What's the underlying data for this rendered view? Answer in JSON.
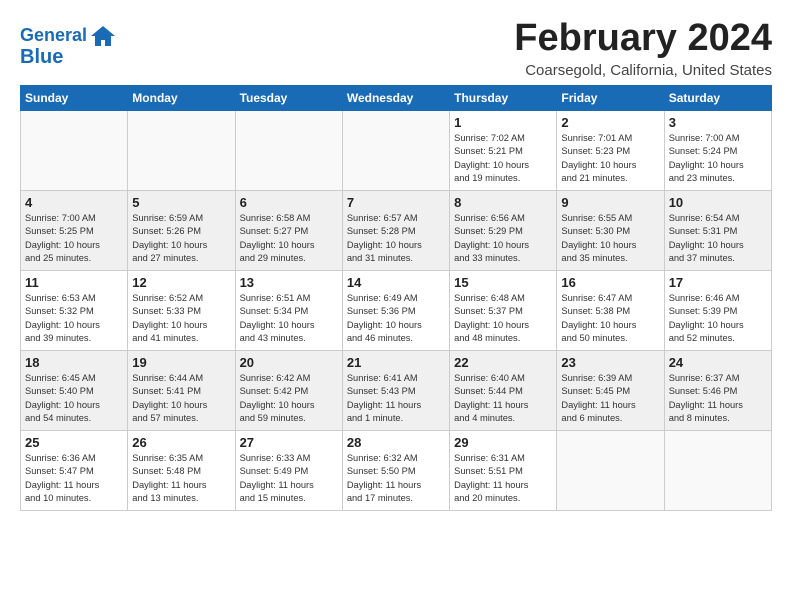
{
  "header": {
    "logo_line1": "General",
    "logo_line2": "Blue",
    "month_title": "February 2024",
    "location": "Coarsegold, California, United States"
  },
  "days_of_week": [
    "Sunday",
    "Monday",
    "Tuesday",
    "Wednesday",
    "Thursday",
    "Friday",
    "Saturday"
  ],
  "weeks": [
    {
      "alt": false,
      "days": [
        {
          "num": "",
          "info": ""
        },
        {
          "num": "",
          "info": ""
        },
        {
          "num": "",
          "info": ""
        },
        {
          "num": "",
          "info": ""
        },
        {
          "num": "1",
          "info": "Sunrise: 7:02 AM\nSunset: 5:21 PM\nDaylight: 10 hours\nand 19 minutes."
        },
        {
          "num": "2",
          "info": "Sunrise: 7:01 AM\nSunset: 5:23 PM\nDaylight: 10 hours\nand 21 minutes."
        },
        {
          "num": "3",
          "info": "Sunrise: 7:00 AM\nSunset: 5:24 PM\nDaylight: 10 hours\nand 23 minutes."
        }
      ]
    },
    {
      "alt": true,
      "days": [
        {
          "num": "4",
          "info": "Sunrise: 7:00 AM\nSunset: 5:25 PM\nDaylight: 10 hours\nand 25 minutes."
        },
        {
          "num": "5",
          "info": "Sunrise: 6:59 AM\nSunset: 5:26 PM\nDaylight: 10 hours\nand 27 minutes."
        },
        {
          "num": "6",
          "info": "Sunrise: 6:58 AM\nSunset: 5:27 PM\nDaylight: 10 hours\nand 29 minutes."
        },
        {
          "num": "7",
          "info": "Sunrise: 6:57 AM\nSunset: 5:28 PM\nDaylight: 10 hours\nand 31 minutes."
        },
        {
          "num": "8",
          "info": "Sunrise: 6:56 AM\nSunset: 5:29 PM\nDaylight: 10 hours\nand 33 minutes."
        },
        {
          "num": "9",
          "info": "Sunrise: 6:55 AM\nSunset: 5:30 PM\nDaylight: 10 hours\nand 35 minutes."
        },
        {
          "num": "10",
          "info": "Sunrise: 6:54 AM\nSunset: 5:31 PM\nDaylight: 10 hours\nand 37 minutes."
        }
      ]
    },
    {
      "alt": false,
      "days": [
        {
          "num": "11",
          "info": "Sunrise: 6:53 AM\nSunset: 5:32 PM\nDaylight: 10 hours\nand 39 minutes."
        },
        {
          "num": "12",
          "info": "Sunrise: 6:52 AM\nSunset: 5:33 PM\nDaylight: 10 hours\nand 41 minutes."
        },
        {
          "num": "13",
          "info": "Sunrise: 6:51 AM\nSunset: 5:34 PM\nDaylight: 10 hours\nand 43 minutes."
        },
        {
          "num": "14",
          "info": "Sunrise: 6:49 AM\nSunset: 5:36 PM\nDaylight: 10 hours\nand 46 minutes."
        },
        {
          "num": "15",
          "info": "Sunrise: 6:48 AM\nSunset: 5:37 PM\nDaylight: 10 hours\nand 48 minutes."
        },
        {
          "num": "16",
          "info": "Sunrise: 6:47 AM\nSunset: 5:38 PM\nDaylight: 10 hours\nand 50 minutes."
        },
        {
          "num": "17",
          "info": "Sunrise: 6:46 AM\nSunset: 5:39 PM\nDaylight: 10 hours\nand 52 minutes."
        }
      ]
    },
    {
      "alt": true,
      "days": [
        {
          "num": "18",
          "info": "Sunrise: 6:45 AM\nSunset: 5:40 PM\nDaylight: 10 hours\nand 54 minutes."
        },
        {
          "num": "19",
          "info": "Sunrise: 6:44 AM\nSunset: 5:41 PM\nDaylight: 10 hours\nand 57 minutes."
        },
        {
          "num": "20",
          "info": "Sunrise: 6:42 AM\nSunset: 5:42 PM\nDaylight: 10 hours\nand 59 minutes."
        },
        {
          "num": "21",
          "info": "Sunrise: 6:41 AM\nSunset: 5:43 PM\nDaylight: 11 hours\nand 1 minute."
        },
        {
          "num": "22",
          "info": "Sunrise: 6:40 AM\nSunset: 5:44 PM\nDaylight: 11 hours\nand 4 minutes."
        },
        {
          "num": "23",
          "info": "Sunrise: 6:39 AM\nSunset: 5:45 PM\nDaylight: 11 hours\nand 6 minutes."
        },
        {
          "num": "24",
          "info": "Sunrise: 6:37 AM\nSunset: 5:46 PM\nDaylight: 11 hours\nand 8 minutes."
        }
      ]
    },
    {
      "alt": false,
      "days": [
        {
          "num": "25",
          "info": "Sunrise: 6:36 AM\nSunset: 5:47 PM\nDaylight: 11 hours\nand 10 minutes."
        },
        {
          "num": "26",
          "info": "Sunrise: 6:35 AM\nSunset: 5:48 PM\nDaylight: 11 hours\nand 13 minutes."
        },
        {
          "num": "27",
          "info": "Sunrise: 6:33 AM\nSunset: 5:49 PM\nDaylight: 11 hours\nand 15 minutes."
        },
        {
          "num": "28",
          "info": "Sunrise: 6:32 AM\nSunset: 5:50 PM\nDaylight: 11 hours\nand 17 minutes."
        },
        {
          "num": "29",
          "info": "Sunrise: 6:31 AM\nSunset: 5:51 PM\nDaylight: 11 hours\nand 20 minutes."
        },
        {
          "num": "",
          "info": ""
        },
        {
          "num": "",
          "info": ""
        }
      ]
    }
  ]
}
